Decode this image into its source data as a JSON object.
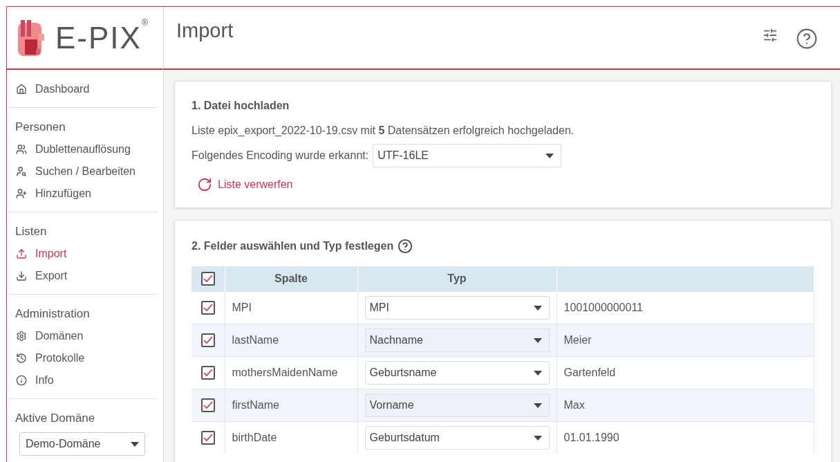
{
  "logo": {
    "text": "E-PIX",
    "mark": "®"
  },
  "header": {
    "title": "Import"
  },
  "sidebar": {
    "sections": [
      {
        "items": [
          {
            "label": "Dashboard",
            "selected": false
          }
        ]
      },
      {
        "title": "Personen",
        "items": [
          {
            "label": "Dublettenauflösung",
            "selected": false
          },
          {
            "label": "Suchen / Bearbeiten",
            "selected": false
          },
          {
            "label": "Hinzufügen",
            "selected": false
          }
        ]
      },
      {
        "title": "Listen",
        "items": [
          {
            "label": "Import",
            "selected": true
          },
          {
            "label": "Export",
            "selected": false
          }
        ]
      },
      {
        "title": "Administration",
        "items": [
          {
            "label": "Domänen",
            "selected": false
          },
          {
            "label": "Protokolle",
            "selected": false
          },
          {
            "label": "Info",
            "selected": false
          }
        ]
      }
    ],
    "active_domain": {
      "title": "Aktive Domäne",
      "value": "Demo-Domäne"
    }
  },
  "upload": {
    "title": "1. Datei hochladen",
    "message": "Liste epix_export_2022-10-19.csv mit **5** Datensätzen erfolgreich hochgeladen.",
    "encoding_label": "Folgendes Encoding wurde erkannt:",
    "encoding": "UTF-16LE",
    "discard": "Liste verwerfen"
  },
  "fields": {
    "title": "2. Felder auswählen und Typ festlegen",
    "columns": [
      "Spalte",
      "Typ"
    ],
    "all_checked": true,
    "rows": [
      {
        "checked": true,
        "column": "MPI",
        "type": "MPI",
        "value": "1001000000011"
      },
      {
        "checked": true,
        "column": "lastName",
        "type": "Nachname",
        "value": "Meier"
      },
      {
        "checked": true,
        "column": "mothersMaidenName",
        "type": "Geburtsname",
        "value": "Gartenfeld"
      },
      {
        "checked": true,
        "column": "firstName",
        "type": "Vorname",
        "value": "Max"
      },
      {
        "checked": true,
        "column": "birthDate",
        "type": "Geburtsdatum",
        "value": "01.01.1990"
      }
    ]
  }
}
